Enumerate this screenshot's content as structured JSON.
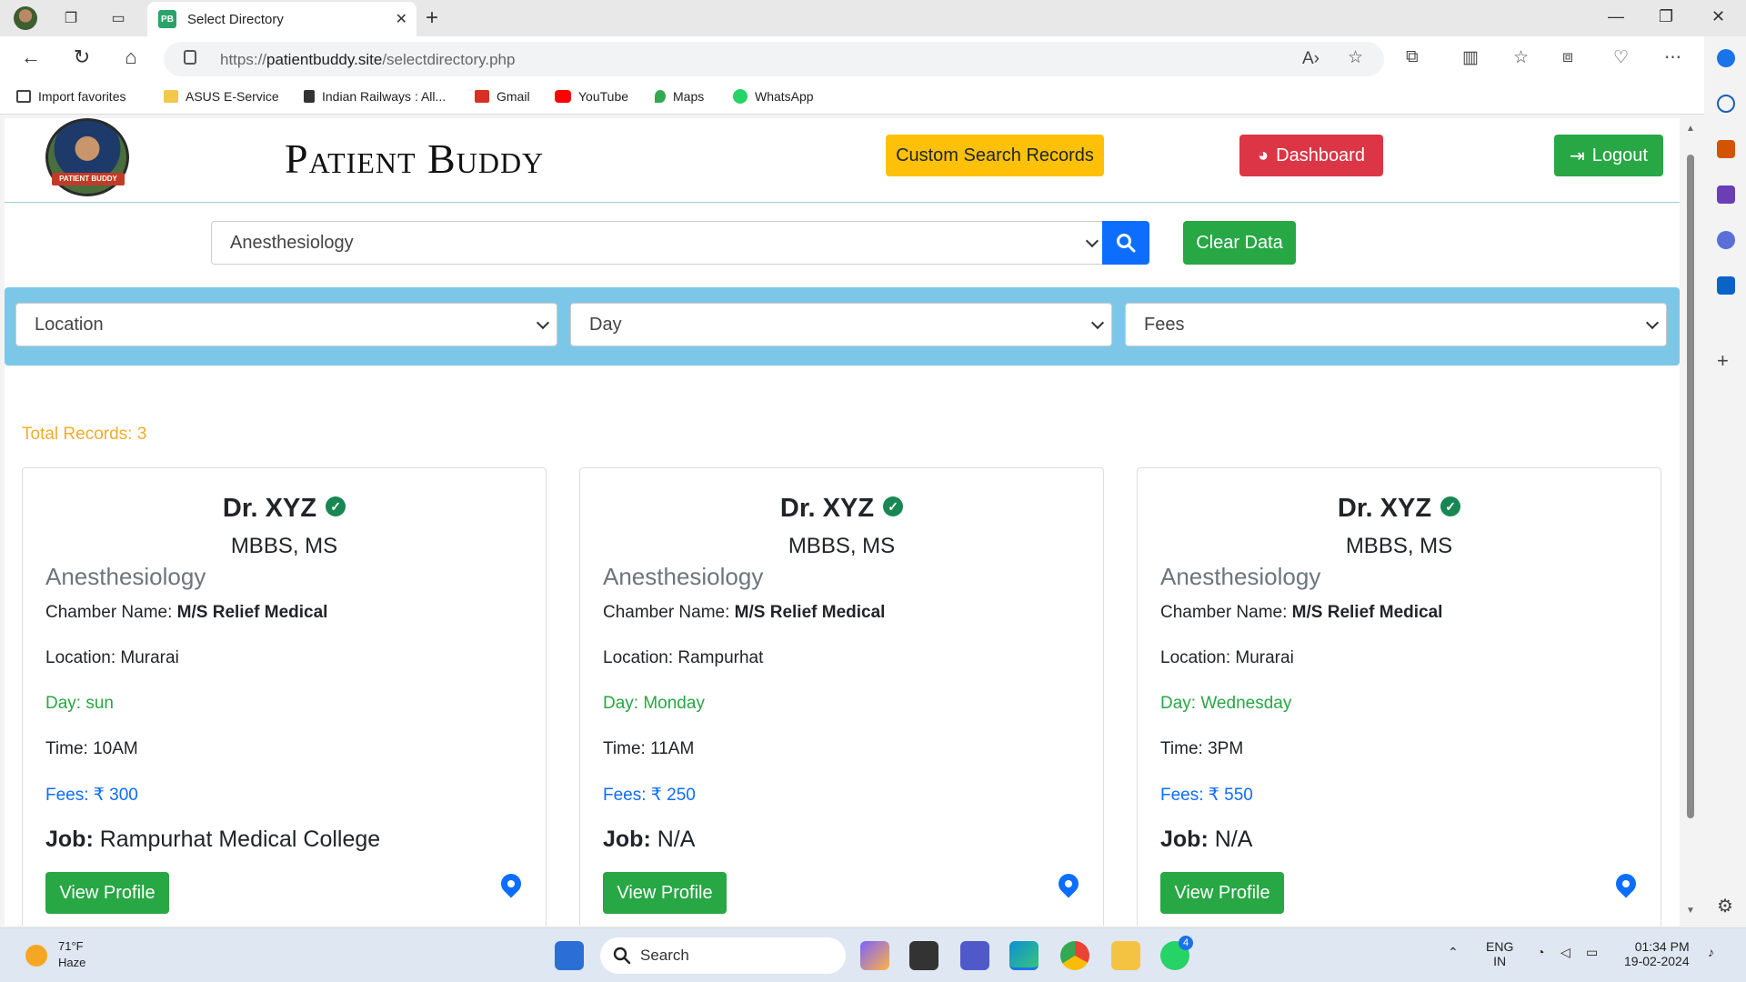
{
  "browser": {
    "tab_title": "Select Directory",
    "tab_favicon": "PB",
    "url_prefix": "https://",
    "url_host": "patientbuddy.site",
    "url_path": "/selectdirectory.php",
    "favorites": [
      "Import favorites",
      "ASUS E-Service",
      "Indian Railways : All...",
      "Gmail",
      "YouTube",
      "Maps",
      "WhatsApp"
    ]
  },
  "site": {
    "brand": "Patient Buddy",
    "logo_text": "PATIENT BUDDY",
    "custom_search_label": "Custom Search Records",
    "dashboard_label": "Dashboard",
    "logout_label": "Logout"
  },
  "search": {
    "selected": "Anesthesiology",
    "clear_label": "Clear Data"
  },
  "filters": {
    "location": "Location",
    "day": "Day",
    "fees": "Fees"
  },
  "total_records": "Total Records: 3",
  "labels": {
    "chamber": "Chamber Name: ",
    "job": "Job: ",
    "view_profile": "View Profile"
  },
  "doctors": [
    {
      "name": "Dr. XYZ",
      "degree": "MBBS, MS",
      "specialty": "Anesthesiology",
      "chamber": "M/S Relief Medical",
      "location": "Location: Murarai",
      "day": "Day: sun",
      "time": "Time: 10AM",
      "fees": "Fees: ₹ 300",
      "job": "Rampurhat Medical College"
    },
    {
      "name": "Dr. XYZ",
      "degree": "MBBS, MS",
      "specialty": "Anesthesiology",
      "chamber": "M/S Relief Medical",
      "location": "Location: Rampurhat",
      "day": "Day: Monday",
      "time": "Time: 11AM",
      "fees": "Fees: ₹ 250",
      "job": "N/A"
    },
    {
      "name": "Dr. XYZ",
      "degree": "MBBS, MS",
      "specialty": "Anesthesiology",
      "chamber": "M/S Relief Medical",
      "location": "Location: Murarai",
      "day": "Day: Wednesday",
      "time": "Time: 3PM",
      "fees": "Fees: ₹ 550",
      "job": "N/A"
    }
  ],
  "taskbar": {
    "temp": "71°F",
    "weather": "Haze",
    "search": "Search",
    "lang1": "ENG",
    "lang2": "IN",
    "time": "01:34 PM",
    "date": "19-02-2024",
    "whatsapp_badge": "4"
  },
  "colors": {
    "accent_blue": "#0d6efd",
    "success_green": "#28a745",
    "danger_red": "#dc3545",
    "warning_yellow": "#ffc107",
    "filter_band": "#7cc7e8",
    "total_orange": "#f0ad2b"
  }
}
